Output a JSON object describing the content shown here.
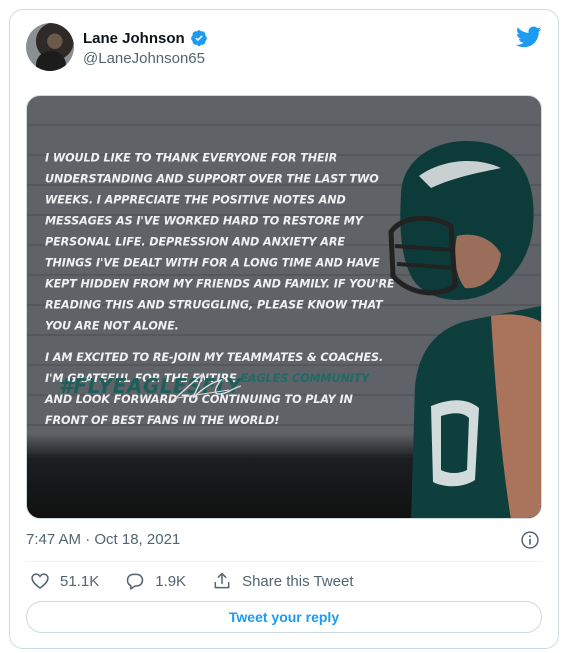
{
  "author": {
    "display_name": "Lane Johnson",
    "handle": "@LaneJohnson65",
    "verified_icon": "verified-badge-icon"
  },
  "media": {
    "paragraphs": [
      "I would like to thank everyone for their understanding and support over the last two weeks. I appreciate the positive notes and messages as I've worked hard to restore my personal life. Depression and anxiety are things I've dealt with for a long time and have kept hidden from my friends and family. If you're reading this and struggling, please know that you are not alone."
    ],
    "p2_before": "I am excited to re-join my teammates & coaches. I'm grateful for the entire ",
    "p2_highlight": "Eagles community",
    "p2_after": " and look forward to continuing to play in front of best fans in the world!",
    "hashtag": "#FLYEAGLESFLY"
  },
  "meta": {
    "timestamp": "7:47 AM · Oct 18, 2021"
  },
  "actions": {
    "likes": "51.1K",
    "replies": "1.9K",
    "share_label": "Share this Tweet"
  },
  "reply": {
    "label": "Tweet your reply"
  },
  "colors": {
    "accent": "#1d9bf0",
    "muted_text": "#536471",
    "eagles_green": "#1f6b67"
  }
}
